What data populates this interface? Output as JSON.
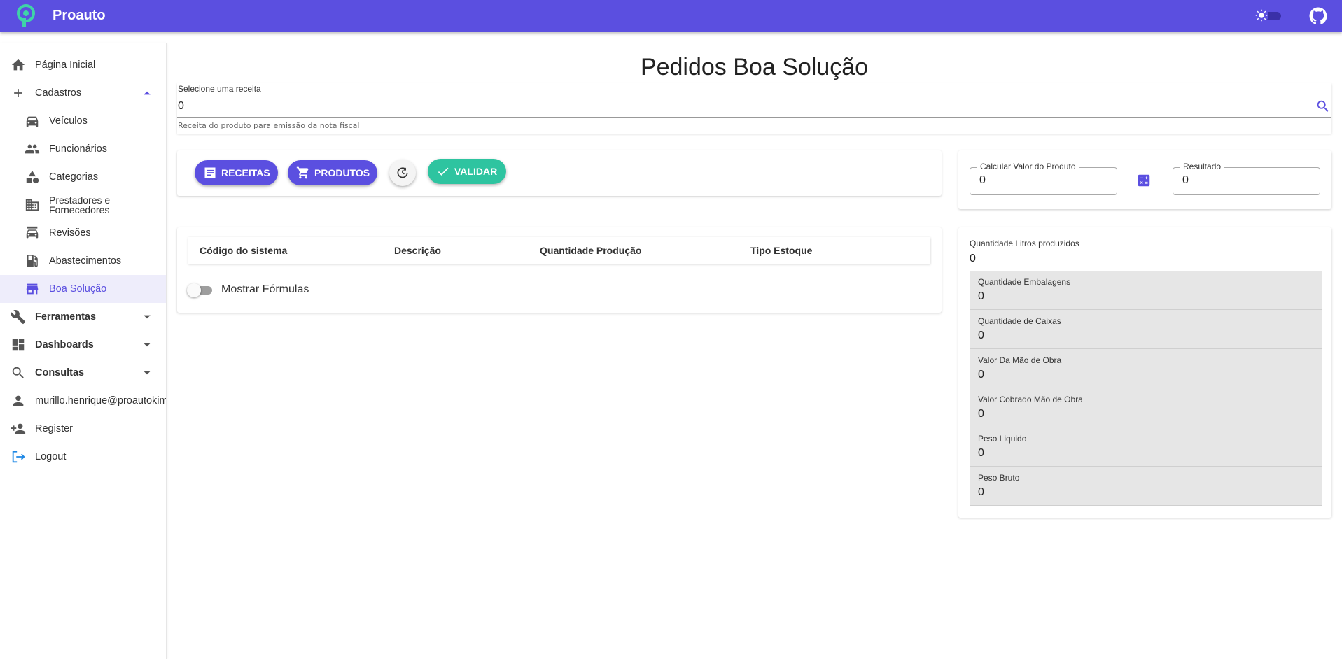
{
  "app": {
    "title": "Proauto"
  },
  "colors": {
    "primary": "#5b4fe0",
    "accent_green": "#2ec4a0",
    "active_bg": "#eeedfb"
  },
  "sidebar": {
    "items": [
      {
        "label": "Página Inicial",
        "icon": "home-icon"
      },
      {
        "label": "Cadastros",
        "icon": "plus-icon",
        "expanded": true
      },
      {
        "label": "Veículos",
        "icon": "car-icon"
      },
      {
        "label": "Funcionários",
        "icon": "people-icon"
      },
      {
        "label": "Categorias",
        "icon": "category-icon"
      },
      {
        "label": "Prestadores e Fornecedores",
        "line1": "Prestadores e",
        "line2": "Fornecedores",
        "icon": "building-icon"
      },
      {
        "label": "Revisões",
        "icon": "car-service-icon"
      },
      {
        "label": "Abastecimentos",
        "icon": "fuel-icon"
      },
      {
        "label": "Boa Solução",
        "icon": "store-icon",
        "active": true
      },
      {
        "label": "Ferramentas",
        "icon": "wrench-icon"
      },
      {
        "label": "Dashboards",
        "icon": "dashboard-icon"
      },
      {
        "label": "Consultas",
        "icon": "search-icon"
      },
      {
        "label": "murillo.henrique@proautokimi",
        "icon": "person-icon"
      },
      {
        "label": "Register",
        "icon": "person-add-icon"
      },
      {
        "label": "Logout",
        "icon": "logout-icon"
      }
    ]
  },
  "main": {
    "title": "Pedidos Boa Solução",
    "recipe": {
      "label": "Selecione uma receita",
      "value": "0",
      "helper": "Receita do produto para emissão da nota fiscal"
    },
    "buttons": {
      "receitas": "RECEITAS",
      "produtos": "PRODUTOS",
      "validar": "VALIDAR"
    },
    "calc": {
      "input_label": "Calcular Valor do Produto",
      "input_value": "0",
      "result_label": "Resultado",
      "result_value": "0"
    },
    "table": {
      "columns": [
        "Código do sistema",
        "Descrição",
        "Quantidade Produção",
        "Tipo Estoque"
      ],
      "toggle_label": "Mostrar Fórmulas"
    },
    "stats": {
      "litros_label": "Quantidade Litros produzidos",
      "litros_value": "0",
      "rows": [
        {
          "label": "Quantidade Embalagens",
          "value": "0"
        },
        {
          "label": "Quantidade de Caixas",
          "value": "0"
        },
        {
          "label": "Valor Da Mão de Obra",
          "value": "0"
        },
        {
          "label": "Valor Cobrado Mão de Obra",
          "value": "0"
        },
        {
          "label": "Peso Liquido",
          "value": "0"
        },
        {
          "label": "Peso Bruto",
          "value": "0"
        }
      ]
    }
  }
}
